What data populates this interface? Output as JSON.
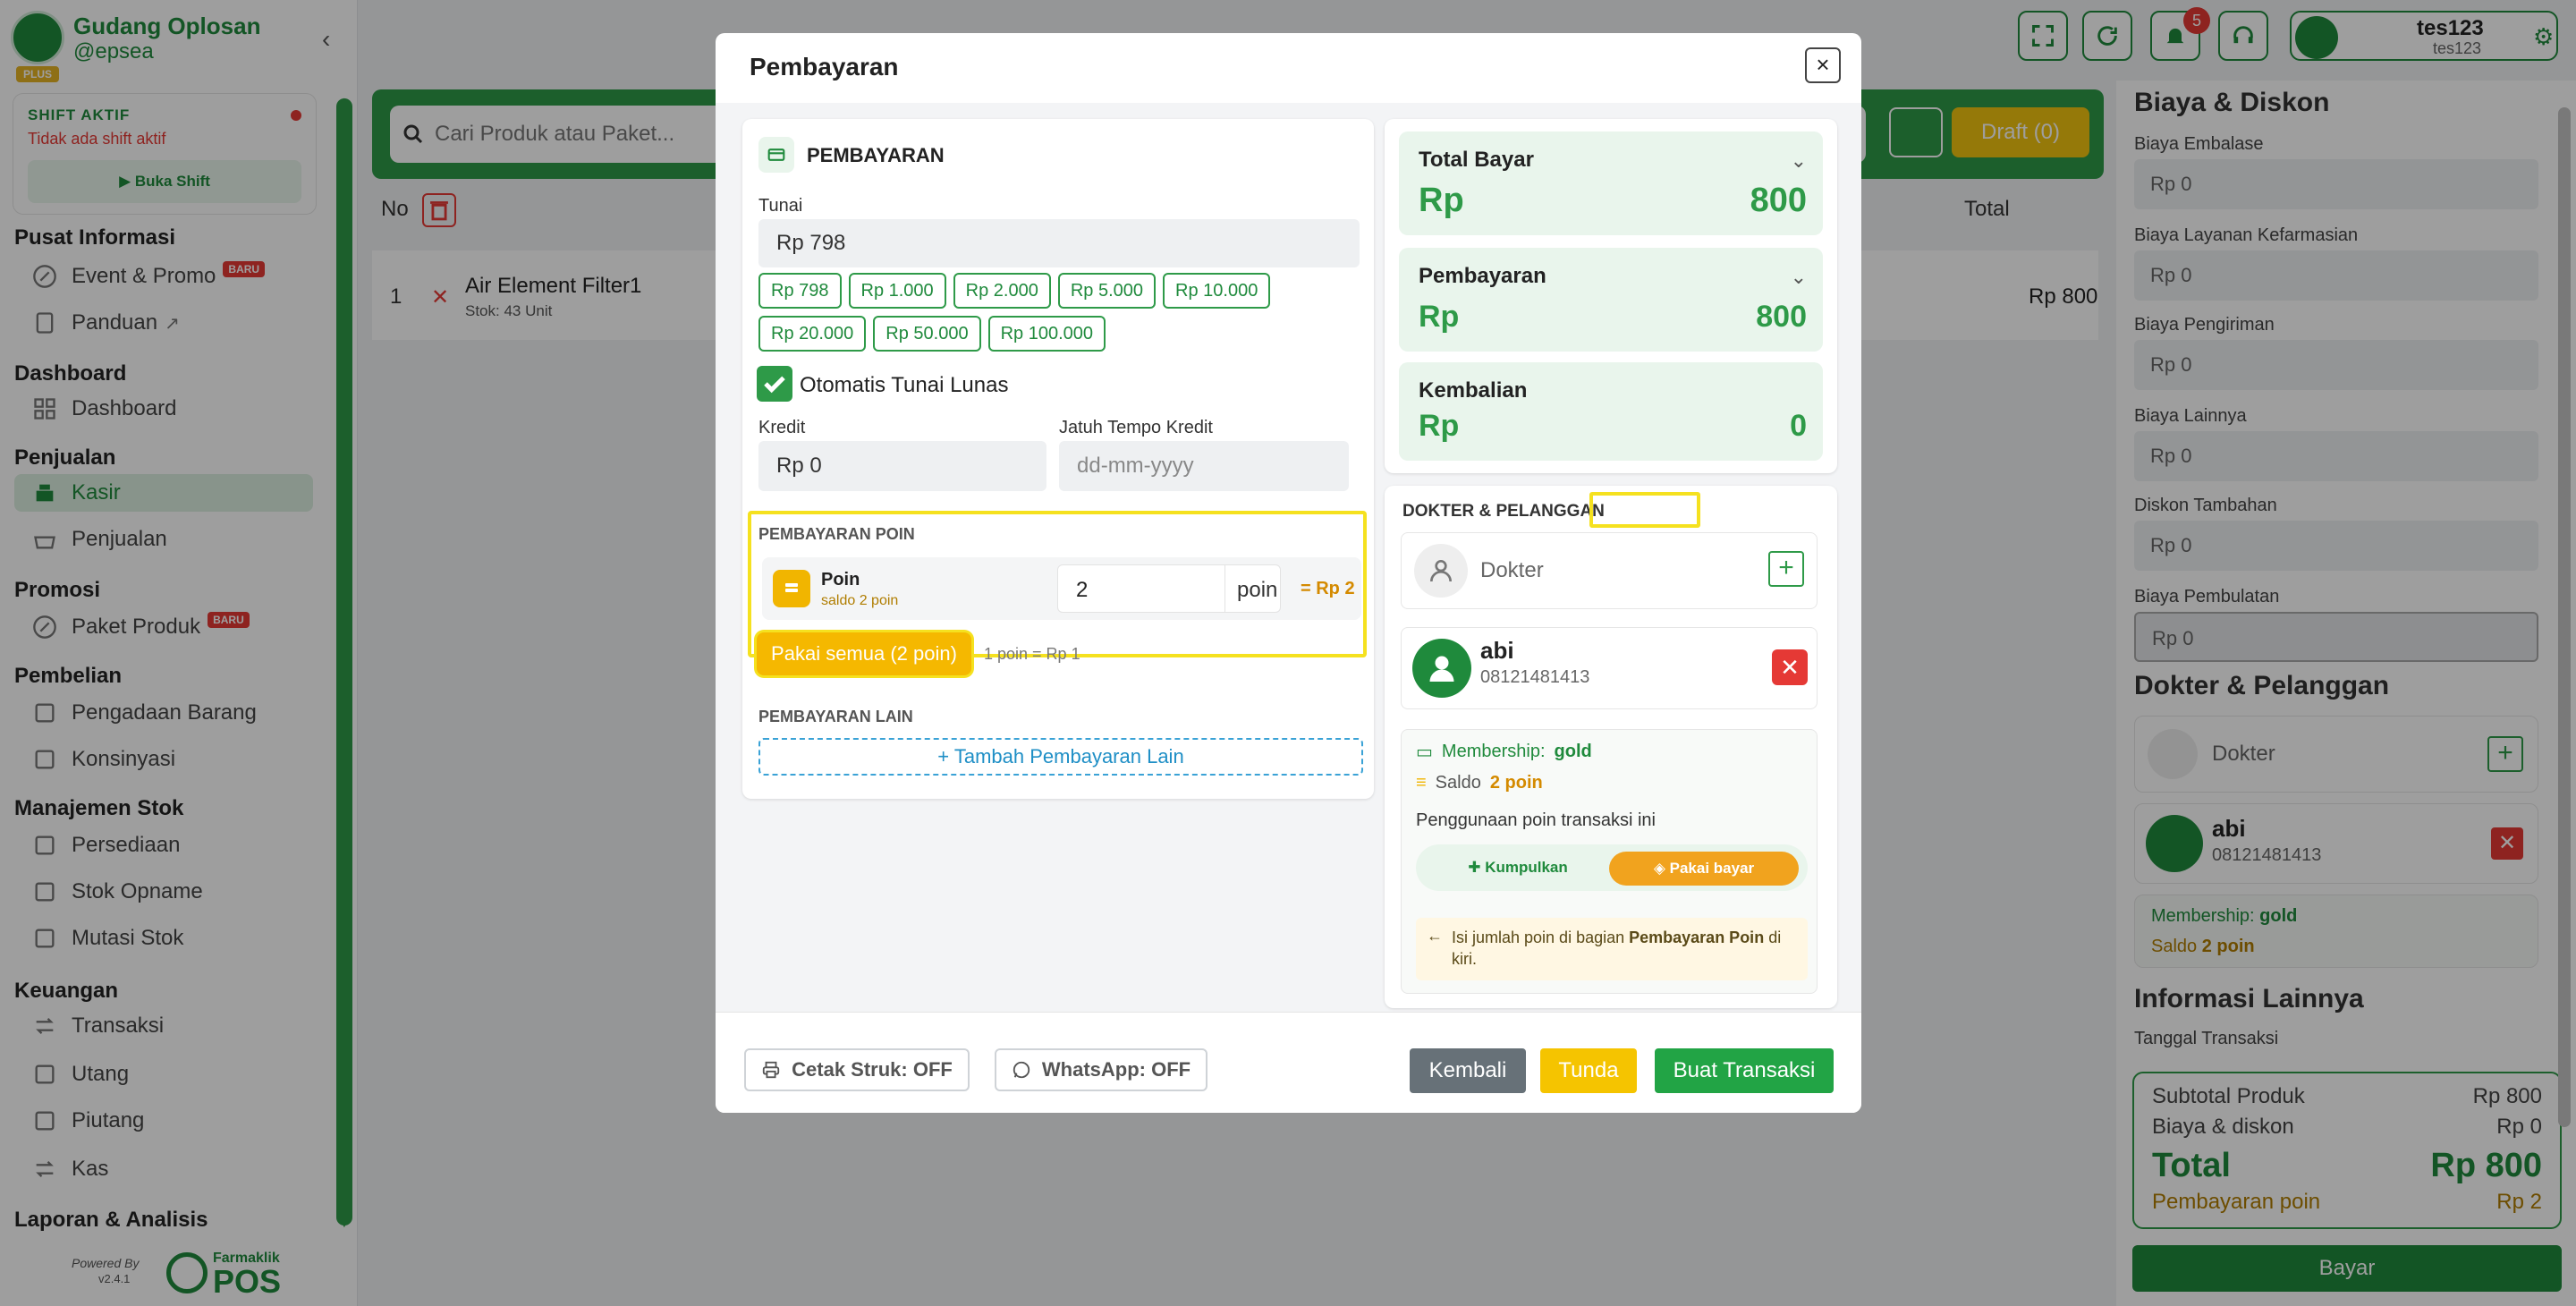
{
  "app": {
    "brand_name": "Gudang Oplosan",
    "brand_user": "@epsea",
    "plan_badge": "PLUS",
    "powered_by": "Powered By",
    "version": "v2.4.1",
    "logo_text": "POS",
    "logo_sub": "Farmaklik"
  },
  "shift": {
    "title": "SHIFT AKTIF",
    "status": "Tidak ada shift aktif",
    "button": "Buka Shift"
  },
  "nav": {
    "sections": [
      {
        "title": "Pusat Informasi"
      },
      {
        "title": "Dashboard"
      },
      {
        "title": "Penjualan"
      },
      {
        "title": "Promosi"
      },
      {
        "title": "Pembelian"
      },
      {
        "title": "Manajemen Stok"
      },
      {
        "title": "Keuangan"
      },
      {
        "title": "Laporan & Analisis"
      }
    ],
    "items": {
      "event": "Event & Promo",
      "panduan": "Panduan",
      "dashboard": "Dashboard",
      "kasir": "Kasir",
      "penjualan": "Penjualan",
      "paket": "Paket Produk",
      "pengadaan": "Pengadaan Barang",
      "konsinyasi": "Konsinyasi",
      "persediaan": "Persediaan",
      "opname": "Stok Opname",
      "mutasi": "Mutasi Stok",
      "transaksi": "Transaksi",
      "utang": "Utang",
      "piutang": "Piutang",
      "kas": "Kas"
    },
    "baru": "BARU"
  },
  "topbar": {
    "notif_count": "5",
    "user_name": "tes123",
    "user_sub": "tes123"
  },
  "main": {
    "search_placeholder": "Cari Produk atau Paket...",
    "draft": "Draft (0)",
    "col_no": "No",
    "col_total": "Total",
    "rows": [
      {
        "no": "1",
        "name": "Air Element Filter1",
        "stok": "Stok: 43 Unit",
        "total": "Rp 800"
      }
    ]
  },
  "right_panel": {
    "title": "Biaya & Diskon",
    "fields": [
      {
        "label": "Biaya Embalase",
        "value": "Rp 0"
      },
      {
        "label": "Biaya Layanan Kefarmasian",
        "value": "Rp 0"
      },
      {
        "label": "Biaya Pengiriman",
        "value": "Rp 0"
      },
      {
        "label": "Biaya Lainnya",
        "value": "Rp 0"
      },
      {
        "label": "Diskon Tambahan",
        "value": "Rp 0"
      },
      {
        "label": "Biaya Pembulatan",
        "value": "Rp 0"
      }
    ],
    "dokter_title": "Dokter & Pelanggan",
    "dokter_placeholder": "Dokter",
    "customer_name": "abi",
    "customer_phone": "08121481413",
    "membership_label": "Membership:",
    "membership_value": "gold",
    "saldo_label": "Saldo",
    "saldo_value": "2 poin",
    "info_title": "Informasi Lainnya",
    "tanggal_label": "Tanggal Transaksi",
    "summary": {
      "subtotal_label": "Subtotal Produk",
      "subtotal": "Rp 800",
      "biaya_label": "Biaya & diskon",
      "biaya": "Rp 0",
      "total_label": "Total",
      "total": "Rp 800",
      "poin_label": "Pembayaran poin",
      "poin": "Rp 2"
    },
    "bayar": "Bayar"
  },
  "modal": {
    "title": "Pembayaran",
    "close": "×",
    "payment_section": "PEMBAYARAN",
    "tunai_label": "Tunai",
    "tunai_value": "Rp 798",
    "chips": [
      "Rp 798",
      "Rp 1.000",
      "Rp 2.000",
      "Rp 5.000",
      "Rp 10.000",
      "Rp 20.000",
      "Rp 50.000",
      "Rp 100.000"
    ],
    "auto_lunas": "Otomatis Tunai Lunas",
    "kredit_label": "Kredit",
    "kredit_value": "Rp 0",
    "jatuh_tempo_label": "Jatuh Tempo Kredit",
    "jatuh_tempo_placeholder": "dd-mm-yyyy",
    "poin_section": "PEMBAYARAN POIN",
    "poin_name": "Poin",
    "poin_saldo": "saldo 2 poin",
    "poin_input": "2",
    "poin_unit": "poin",
    "poin_rp": "= Rp 2",
    "pakai_semua": "Pakai semua (2 poin)",
    "poin_rate": "1 poin = Rp 1",
    "lain_section": "PEMBAYARAN LAIN",
    "tambah": "Tambah Pembayaran Lain",
    "total_bayar_label": "Total Bayar",
    "total_bayar_rp": "Rp",
    "total_bayar_value": "800",
    "pembayaran_label": "Pembayaran",
    "pembayaran_rp": "Rp",
    "pembayaran_value": "800",
    "kembalian_label": "Kembalian",
    "kembalian_rp": "Rp",
    "kembalian_value": "0",
    "dokter_section": "DOKTER & PELANGGAN",
    "dokter_placeholder": "Dokter",
    "customer_name": "abi",
    "customer_phone": "08121481413",
    "membership_label": "Membership:",
    "membership_value": "gold",
    "saldo_label": "Saldo",
    "saldo_value": "2 poin",
    "penggunaan_label": "Penggunaan poin transaksi ini",
    "kumpulkan": "Kumpulkan",
    "pakai_bayar": "Pakai bayar",
    "hint_pre": "Isi jumlah poin di bagian ",
    "hint_bold": "Pembayaran Poin",
    "hint_post": " di kiri.",
    "cetak_struk": "Cetak Struk: OFF",
    "whatsapp": "WhatsApp: OFF",
    "kembali": "Kembali",
    "tunda": "Tunda",
    "buat_transaksi": "Buat Transaksi"
  },
  "colors": {
    "brand": "#1f8a3c",
    "accent_yellow": "#f5c400",
    "highlight": "#f5e11f",
    "danger": "#e53935"
  }
}
